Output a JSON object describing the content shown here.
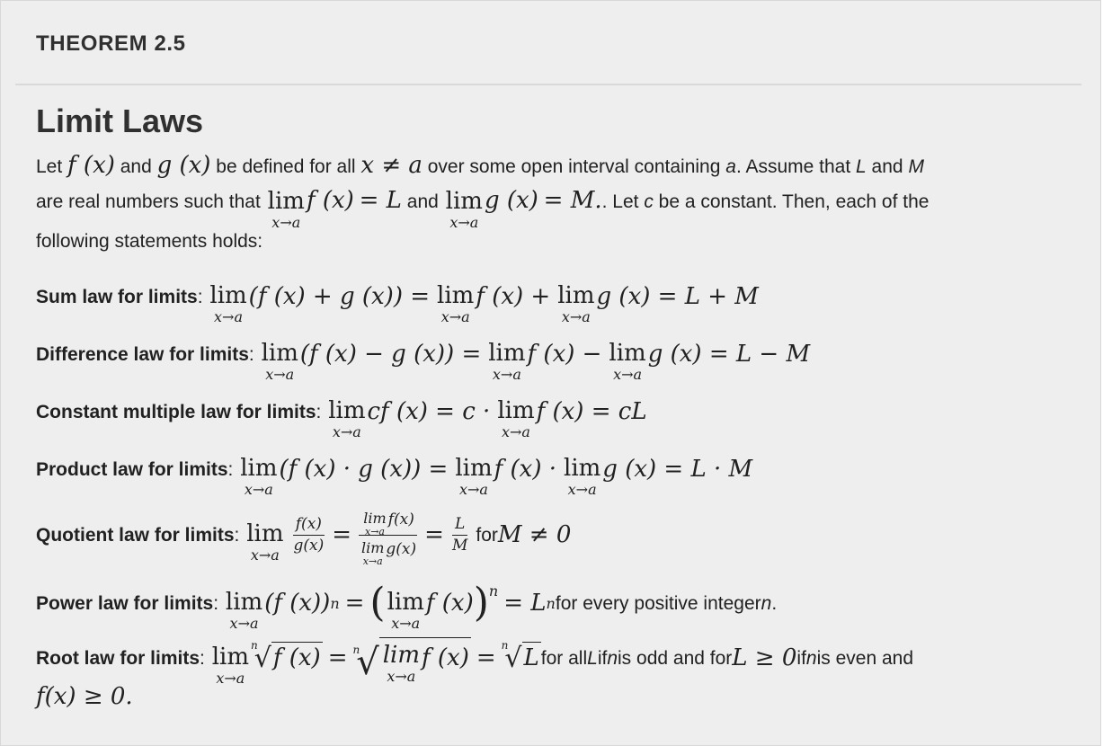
{
  "header": {
    "label": "THEOREM 2.5"
  },
  "title": "Limit Laws",
  "intro": {
    "t1": "Let ",
    "t2": " and ",
    "t3": " be defined for all ",
    "t4": " over some open interval containing ",
    "var_a": "a",
    "t5": ". Assume that ",
    "var_L": "L",
    "t6": " and ",
    "var_M": "M",
    "t7": "are real numbers such that ",
    "t8": " and ",
    "t9": ". Let ",
    "var_c": "c",
    "t10": " be a constant. Then, each of the",
    "t11": "following statements holds:"
  },
  "laws": [
    {
      "name": "Sum law for limits"
    },
    {
      "name": "Difference law for limits"
    },
    {
      "name": "Constant multiple law for limits"
    },
    {
      "name": "Product law for limits"
    },
    {
      "name": "Quotient law for limits",
      "suffix": " for "
    },
    {
      "name": "Power law for limits",
      "suffix": " for every positive integer ",
      "var": "n",
      "end": "."
    },
    {
      "name": "Root law for limits",
      "s1": " for all ",
      "s2": " if ",
      "s3": " is odd and for ",
      "s4": " if ",
      "s5": " is even and"
    }
  ],
  "math": {
    "fx": "f (x)",
    "gx": "g (x)",
    "x_ne_a": "x ≠ a",
    "lim": "lim",
    "x_to_a": "x→a",
    "eq_L": "= L",
    "eq_M": "= M.",
    "sum_lhs": "(f (x) + g (x)) =",
    "sum_mid": "f (x) +",
    "sum_rhs": "g (x) = L + M",
    "diff_lhs": "(f (x) − g (x)) =",
    "diff_mid": "f (x) −",
    "diff_rhs": "g (x) = L − M",
    "const_lhs": "cf (x) = c ·",
    "const_rhs": "f (x) = cL",
    "prod_lhs": "(f (x) · g (x)) =",
    "prod_mid": "f (x) ·",
    "prod_rhs": "g (x) = L · M",
    "quot_num": "f(x)",
    "quot_den": "g(x)",
    "quot_L": "L",
    "quot_M": "M",
    "quot_cond": "M ≠ 0",
    "pow_lhs": "(f (x))",
    "pow_n": "n",
    "pow_inner": "f (x)",
    "pow_rhs": "= L",
    "root_n": "n",
    "root_inner": "f (x)",
    "root_L": "L",
    "root_L2": "L",
    "L_ge_0": "L ≥ 0",
    "final": "f(x) ≥ 0."
  }
}
